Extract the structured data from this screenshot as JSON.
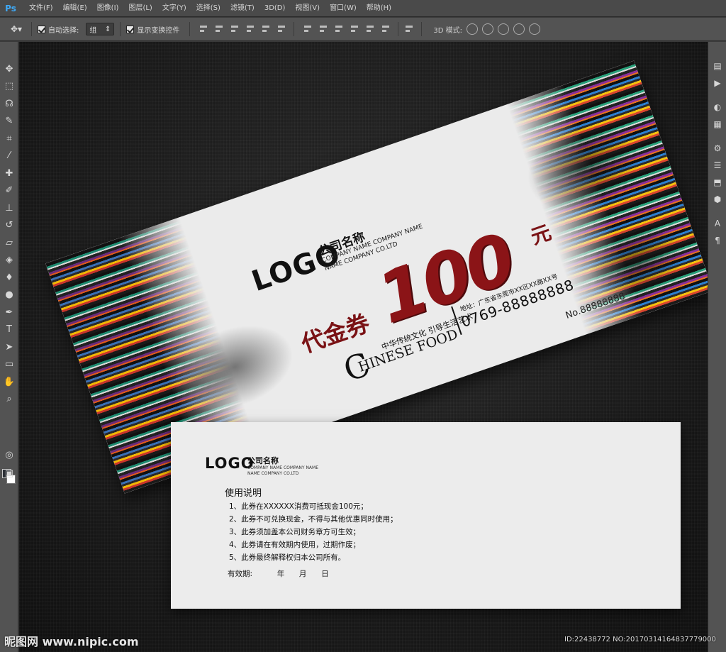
{
  "app": {
    "logo": "Ps"
  },
  "menu": [
    "文件(F)",
    "编辑(E)",
    "图像(I)",
    "图层(L)",
    "文字(Y)",
    "选择(S)",
    "滤镜(T)",
    "3D(D)",
    "视图(V)",
    "窗口(W)",
    "帮助(H)"
  ],
  "options_bar": {
    "auto_select_label": "自动选择:",
    "auto_select_value": "组",
    "show_transform_label": "显示变换控件",
    "mode_3d_label": "3D 模式:"
  },
  "colors": {
    "foreground": "#2b2f35",
    "background": "#ffffff",
    "accent_red": "#8b1417"
  },
  "front_card": {
    "logo": "LOGO",
    "company_name": "公司名称",
    "company_en_1": "COMPANY NAME COMPANY NAME",
    "company_en_2": "NAME COMPANY CO.LTD",
    "voucher_label": "代金券",
    "amount": "100",
    "unit": "元",
    "slogan": "中华传统文化  引导生活艺术",
    "chinese_food_c": "C",
    "chinese_food": "HINESE FOOD",
    "address": "地址：广东省东莞市XX区XX路XX号",
    "phone": "0769-88888888",
    "serial": "No.88888888"
  },
  "back_card": {
    "logo": "LOGO",
    "company_name": "公司名称",
    "company_en_1": "COMPANY NAME COMPANY NAME",
    "company_en_2": "NAME COMPANY CO.LTD",
    "heading": "使用说明",
    "rules": [
      "1、此券在XXXXXX消费可抵现金100元；",
      "2、此券不可兑换现金，不得与其他优惠同时使用；",
      "3、此券须加盖本公司财务章方可生效；",
      "4、此券请在有效期内使用，过期作废；",
      "5、此券最终解释权归本公司所有。"
    ],
    "validity_label": "有效期:",
    "year": "年",
    "month": "月",
    "day": "日"
  },
  "watermark": {
    "left": "昵图网 www.nipic.com",
    "right": "ID:22438772 NO:20170314164837779000"
  }
}
